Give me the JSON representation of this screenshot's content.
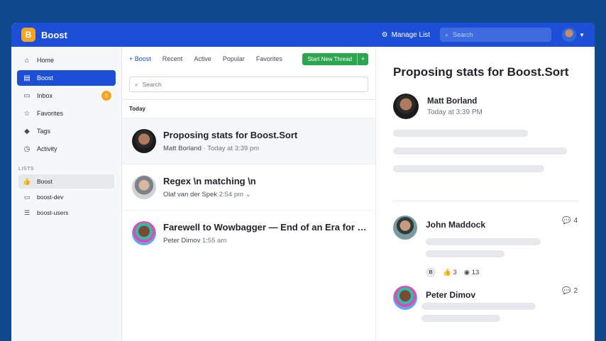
{
  "header": {
    "app_title": "Boost",
    "logo_letter": "B",
    "manage_list": "Manage List",
    "search_placeholder": "Search"
  },
  "sidebar": {
    "items": [
      {
        "label": "Home",
        "icon": "home-icon"
      },
      {
        "label": "Boost",
        "icon": "boost-icon",
        "active": true
      },
      {
        "label": "Inbox",
        "icon": "inbox-icon",
        "badge": "5"
      },
      {
        "label": "Favorites",
        "icon": "star-icon"
      },
      {
        "label": "Tags",
        "icon": "tag-icon"
      },
      {
        "label": "Activity",
        "icon": "clock-icon"
      }
    ],
    "lists_label": "LISTS",
    "lists": [
      {
        "label": "Boost",
        "icon": "thumbs-up-icon",
        "active": true
      },
      {
        "label": "boost-dev",
        "icon": "folder-icon"
      },
      {
        "label": "boost-users",
        "icon": "list-icon"
      }
    ]
  },
  "threads": {
    "tabs": [
      "+ Boost",
      "Recent",
      "Active",
      "Popular",
      "Favorites"
    ],
    "new_thread": "Start New Thread",
    "new_thread_plus": "+",
    "search_placeholder": "Search",
    "section": "Today",
    "items": [
      {
        "title": "Proposing stats for Boost.Sort",
        "author": "Matt Borland",
        "time": "· Today at 3:39 pm"
      },
      {
        "title": "Regex \\n matching \\n",
        "author": "Olaf van der Spek",
        "time": "2:54 pm",
        "chevron": "⌄"
      },
      {
        "title": "Farewell to Wowbagger — End of an Era for boost.org",
        "author": "Peter Dimov",
        "time": "1:55 am"
      }
    ]
  },
  "detail": {
    "title": "Proposing stats for Boost.Sort",
    "author": "Matt Borland",
    "time": "Today at 3:39 PM",
    "replies": [
      {
        "name": "John Maddock",
        "count": "4",
        "badge": "B",
        "likes": "3",
        "views": "13"
      },
      {
        "name": "Peter Dimov",
        "count": "2"
      }
    ]
  },
  "colors": {
    "primary": "#1c4fd6",
    "green": "#2da44e",
    "badge": "#f5a524",
    "background": "#0f4a8c"
  }
}
